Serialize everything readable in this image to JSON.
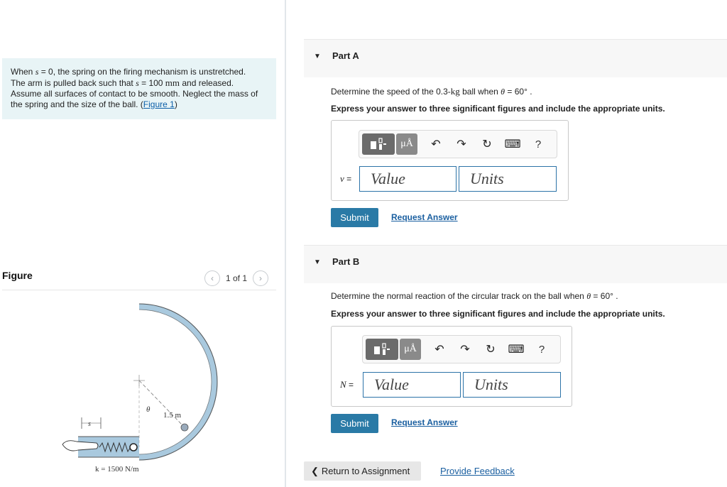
{
  "problem": {
    "line1_a": "When ",
    "s": "s",
    "line1_b": " = 0, the spring on the firing mechanism is unstretched.",
    "line2_a": "The arm is pulled back such that ",
    "line2_b": " = 100 ",
    "unit_mm": "mm",
    "line2_c": " and released.",
    "line3": "Assume all surfaces of contact to be smooth. Neglect the mass of",
    "line4": "the spring and the size of the ball. (",
    "figure_link": "Figure 1",
    "line4_end": ")"
  },
  "figure": {
    "title": "Figure",
    "prev_icon": "chevron-left-icon",
    "next_icon": "chevron-right-icon",
    "count": "1 of 1",
    "label_radius": "1.5 m",
    "label_theta": "θ",
    "label_s": "s",
    "label_k": "k = 1500 N/m"
  },
  "parts": [
    {
      "title": "Part A",
      "question_a": "Determine the speed of the 0.3-",
      "question_unit": "kg",
      "question_b": " ball when ",
      "question_theta": "θ",
      "question_c": " = 60° .",
      "instruction": "Express your answer to three significant figures and include the appropriate units.",
      "var": "v",
      "var_eq": " =",
      "value_placeholder": "Value",
      "units_placeholder": "Units",
      "submit": "Submit",
      "request": "Request Answer"
    },
    {
      "title": "Part B",
      "question_a": "Determine the normal reaction of the circular track on the ball when ",
      "question_theta": "θ",
      "question_c": " = 60° .",
      "instruction": "Express your answer to three significant figures and include the appropriate units.",
      "var": "N",
      "var_eq": " =",
      "value_placeholder": "Value",
      "units_placeholder": "Units",
      "submit": "Submit",
      "request": "Request Answer"
    }
  ],
  "toolbar": {
    "templates_icon": "templates-icon",
    "units_glyph": "μÅ",
    "undo_icon": "undo-icon",
    "redo_icon": "redo-icon",
    "reset_icon": "reset-icon",
    "keyboard_icon": "keyboard-icon",
    "help": "?"
  },
  "footer": {
    "return_arrow": "❮",
    "return": "Return to Assignment",
    "feedback": "Provide Feedback"
  },
  "colors": {
    "accent": "#2a7aa6",
    "link": "#1a5fa0",
    "problem_bg": "#e8f4f6",
    "track": "#a9c9de"
  }
}
